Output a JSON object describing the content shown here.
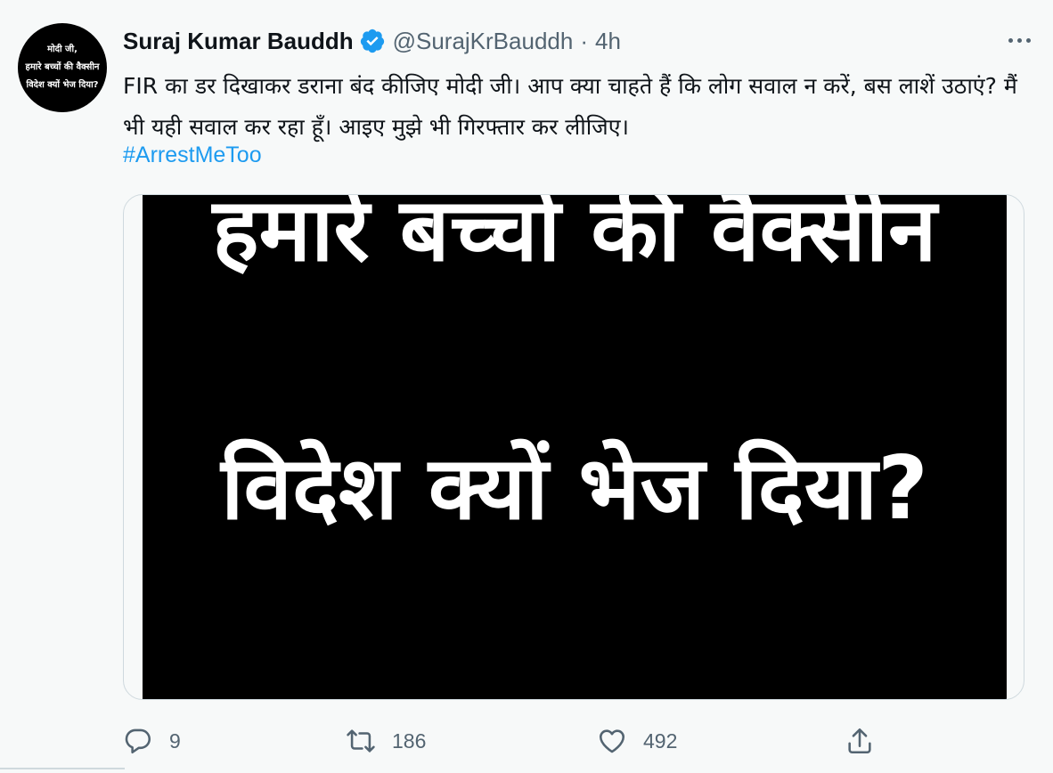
{
  "avatar": {
    "lines": [
      "मोदी जी,",
      "हमारे बच्चों की वैक्सीन",
      "विदेश क्यों भेज दिया?"
    ]
  },
  "tweet": {
    "author_name": "Suraj Kumar Bauddh",
    "handle": "@SurajKrBauddh",
    "separator": "·",
    "time": "4h",
    "text": "FIR का डर दिखाकर डराना बंद कीजिए मोदी जी। आप क्या चाहते हैं कि लोग सवाल न करें, बस लाशें उठाएं? मैं भी यही सवाल कर रहा हूँ। आइए मुझे भी गिरफ्तार कर लीजिए।",
    "hashtag": "#ArrestMeToo"
  },
  "media": {
    "line1": "हमारे बच्चों की वैक्सीन",
    "line2": "विदेश क्यों भेज दिया?"
  },
  "actions": {
    "reply_count": "9",
    "retweet_count": "186",
    "like_count": "492"
  },
  "icons": {
    "verified": "verified-badge-icon",
    "more": "more-options-icon",
    "reply": "reply-icon",
    "retweet": "retweet-icon",
    "like": "heart-icon",
    "share": "share-icon"
  },
  "colors": {
    "accent": "#1d9bf0",
    "secondary_text": "#536471",
    "background": "#f7f9f9"
  }
}
